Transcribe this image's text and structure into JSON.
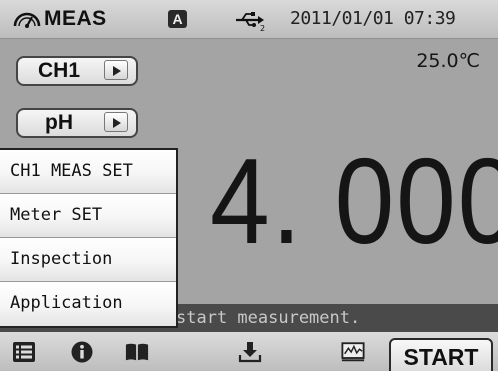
{
  "status_bar": {
    "mode_icon": "gauge-icon",
    "mode_label": "MEAS",
    "auto_badge": "A",
    "usb_icon": "usb-icon",
    "datetime": "2011/01/01 07:39"
  },
  "temperature": "25.0℃",
  "channel_selector": {
    "label": "CH1",
    "arrow_icon": "triangle-right-icon"
  },
  "parameter_selector": {
    "label": "pH",
    "arrow_icon": "triangle-right-icon"
  },
  "reading": {
    "value": "4. 000"
  },
  "message": "start measurement.",
  "menu": {
    "items": [
      {
        "label": "CH1 MEAS SET"
      },
      {
        "label": "Meter SET"
      },
      {
        "label": "Inspection"
      },
      {
        "label": "Application"
      }
    ]
  },
  "toolbar": {
    "menu_icon": "list-icon",
    "info_icon": "info-icon",
    "manual_icon": "book-icon",
    "save_icon": "download-icon",
    "graph_icon": "graph-icon",
    "start_label": "START"
  },
  "colors": {
    "screen_background": "#a4a4a4",
    "message_bar": "#4a4a4a",
    "text": "#151515"
  }
}
